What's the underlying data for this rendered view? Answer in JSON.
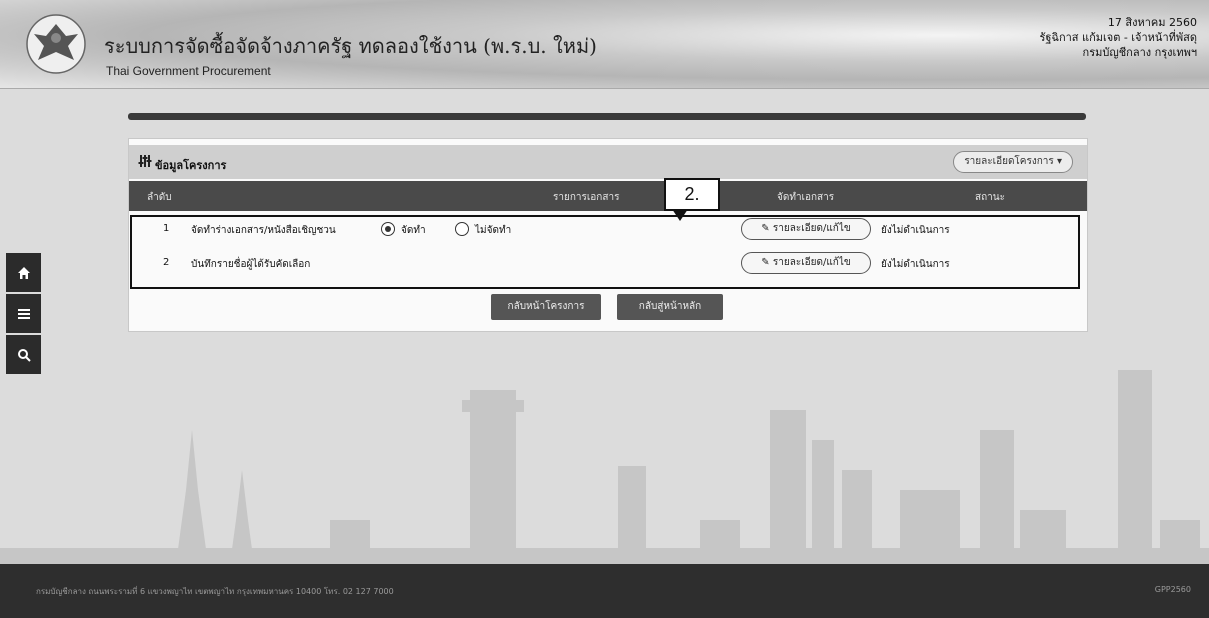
{
  "header": {
    "title": "ระบบการจัดซื้อจัดจ้างภาครัฐ ทดลองใช้งาน (พ.ร.บ. ใหม่)",
    "subtitle": "Thai Government Procurement",
    "date": "17 สิงหาคม 2560",
    "user": "รัฐฉิกาส แก้มเจต - เจ้าหน้าที่พัสดุ",
    "department": "กรมบัญชีกลาง กรุงเทพฯ"
  },
  "rail": {
    "icons": [
      "home-icon",
      "menu-icon",
      "search-icon"
    ]
  },
  "panel": {
    "title": "ข้อมูลโครงการ",
    "detail_button": "รายละเอียดโครงการ ▾",
    "columns": [
      "ลำดับ",
      "รายการเอกสาร",
      "จัดทำเอกสาร",
      "สถานะ"
    ],
    "rows": [
      {
        "no": "1",
        "name": "จัดทำร่างเอกสาร/หนังสือเชิญชวน",
        "option_yes": "จัดทำ",
        "option_no": "ไม่จัดทำ",
        "selected": "จัดทำ",
        "action": "รายละเอียด/แก้ไข",
        "status": "ยังไม่ดำเนินการ"
      },
      {
        "no": "2",
        "name": "บันทึกรายชื่อผู้ได้รับคัดเลือก",
        "action": "รายละเอียด/แก้ไข",
        "status": "ยังไม่ดำเนินการ"
      }
    ],
    "buttons": {
      "back": "กลับหน้าโครงการ",
      "home": "กลับสู่หน้าหลัก"
    }
  },
  "annotation": {
    "callout": "2."
  },
  "footer": {
    "text": "กรมบัญชีกลาง ถนนพระรามที่ 6 แขวงพญาไท เขตพญาไท กรุงเทพมหานคร 10400 โทร. 02 127 7000",
    "version": "GPP2560"
  }
}
